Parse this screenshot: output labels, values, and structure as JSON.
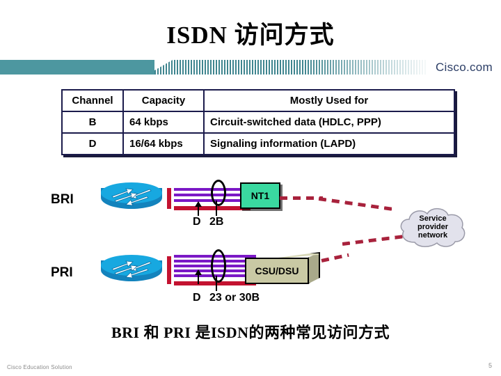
{
  "slide": {
    "title": "ISDN  访问方式",
    "caption": "BRI  和  PRI  是ISDN的两种常见访问方式"
  },
  "banner": {
    "brand": "Cisco.com"
  },
  "table": {
    "headers": [
      "Channel",
      "Capacity",
      "Mostly Used for"
    ],
    "rows": [
      {
        "channel": "B",
        "capacity": "64 kbps",
        "used_for": "Circuit-switched data (HDLC, PPP)"
      },
      {
        "channel": "D",
        "capacity": "16/64 kbps",
        "used_for": "Signaling information (LAPD)"
      }
    ]
  },
  "diagram": {
    "bri": {
      "label": "BRI",
      "router_icon": "cisco-router-icon",
      "d_label": "D",
      "b_label": "2B",
      "device": "NT1",
      "b_channel_count": 3,
      "line_color_b": "#7b18c6",
      "line_color_d": "#c31230"
    },
    "pri": {
      "label": "PRI",
      "router_icon": "cisco-router-icon",
      "d_label": "D",
      "b_label": "23 or 30B",
      "device": "CSU/DSU",
      "b_channel_count": 6,
      "line_color_b": "#7b18c6",
      "line_color_d": "#c31230"
    },
    "cloud": {
      "line1": "Service",
      "line2": "provider",
      "line3": "network",
      "fill": "#e2e2ec"
    }
  },
  "footer": {
    "left": "Cisco Education Solution",
    "page": "5"
  }
}
